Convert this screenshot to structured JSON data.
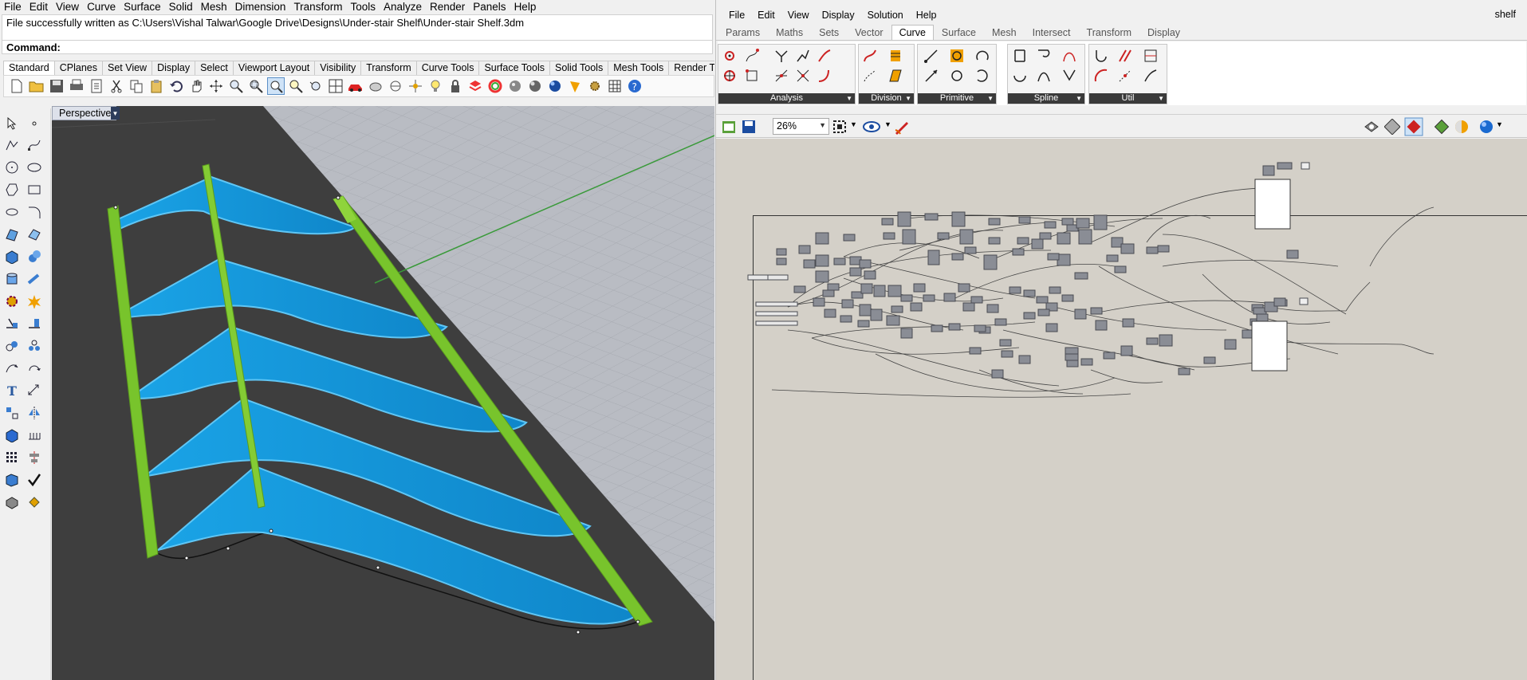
{
  "rhino": {
    "menu": [
      "File",
      "Edit",
      "View",
      "Curve",
      "Surface",
      "Solid",
      "Mesh",
      "Dimension",
      "Transform",
      "Tools",
      "Analyze",
      "Render",
      "Panels",
      "Help"
    ],
    "history_line": "File successfully written as C:\\Users\\Vishal Talwar\\Google Drive\\Designs\\Under-stair Shelf\\Under-stair Shelf.3dm",
    "command_label": "Command:",
    "toolbar_tabs": [
      "Standard",
      "CPlanes",
      "Set View",
      "Display",
      "Select",
      "Viewport Layout",
      "Visibility",
      "Transform",
      "Curve Tools",
      "Surface Tools",
      "Solid Tools",
      "Mesh Tools",
      "Render Tools"
    ],
    "viewport_label": "Perspective",
    "colors": {
      "shelf": "#1a9ad8",
      "frame": "#77c42a",
      "ground": "#404040",
      "grid_bg": "#b9bcc3"
    }
  },
  "grasshopper": {
    "menu": [
      "File",
      "Edit",
      "View",
      "Display",
      "Solution",
      "Help"
    ],
    "document_title": "shelf",
    "tabs": [
      "Params",
      "Maths",
      "Sets",
      "Vector",
      "Curve",
      "Surface",
      "Mesh",
      "Intersect",
      "Transform",
      "Display"
    ],
    "active_tab": "Curve",
    "panels": [
      "Analysis",
      "Division",
      "Primitive",
      "Spline",
      "Util"
    ],
    "zoom": "26%",
    "colors": {
      "canvas": "#d4d0c8",
      "component": "#8a8d95",
      "panel_label_bg": "#3a3a3a"
    }
  }
}
